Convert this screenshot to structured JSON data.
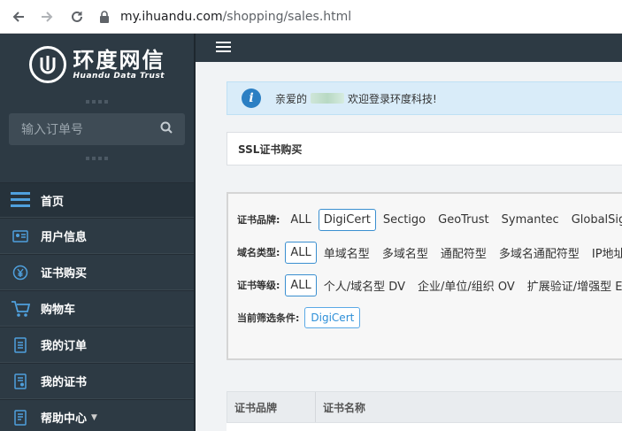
{
  "browser": {
    "url_host": "my.ihuandu.com",
    "url_path": "/shopping/sales.html"
  },
  "sidebar": {
    "logo_cn": "环度网信",
    "logo_en": "Huandu Data Trust",
    "search_placeholder": "输入订单号",
    "items": [
      {
        "label": "首页",
        "icon": "menu-lines-icon"
      },
      {
        "label": "用户信息",
        "icon": "id-card-icon"
      },
      {
        "label": "证书购买",
        "icon": "yen-icon"
      },
      {
        "label": "购物车",
        "icon": "cart-icon"
      },
      {
        "label": "我的订单",
        "icon": "document-icon"
      },
      {
        "label": "我的证书",
        "icon": "certificate-icon"
      },
      {
        "label": "帮助中心",
        "icon": "help-icon"
      }
    ]
  },
  "notice": {
    "prefix": "亲爱的",
    "suffix": "欢迎登录环度科技!"
  },
  "panel": {
    "title": "SSL证书购买"
  },
  "filters": {
    "brand_label": "证书品牌:",
    "brand_options": [
      "ALL",
      "DigiCert",
      "Sectigo",
      "GeoTrust",
      "Symantec",
      "GlobalSign"
    ],
    "domain_label": "域名类型:",
    "domain_options": [
      "ALL",
      "单域名型",
      "多域名型",
      "通配符型",
      "多域名通配符型",
      "IP地址"
    ],
    "level_label": "证书等级:",
    "level_options": [
      "ALL",
      "个人/域名型 DV",
      "企业/单位/组织 OV",
      "扩展验证/增强型 EV"
    ],
    "current_label": "当前筛选条件:",
    "current_value": "DigiCert"
  },
  "table": {
    "headers": [
      "证书品牌",
      "证书名称"
    ]
  },
  "colors": {
    "sidebar_bg": "#2d3a44",
    "accent": "#3a8fd0",
    "notice_bg": "#d9ecf9"
  }
}
